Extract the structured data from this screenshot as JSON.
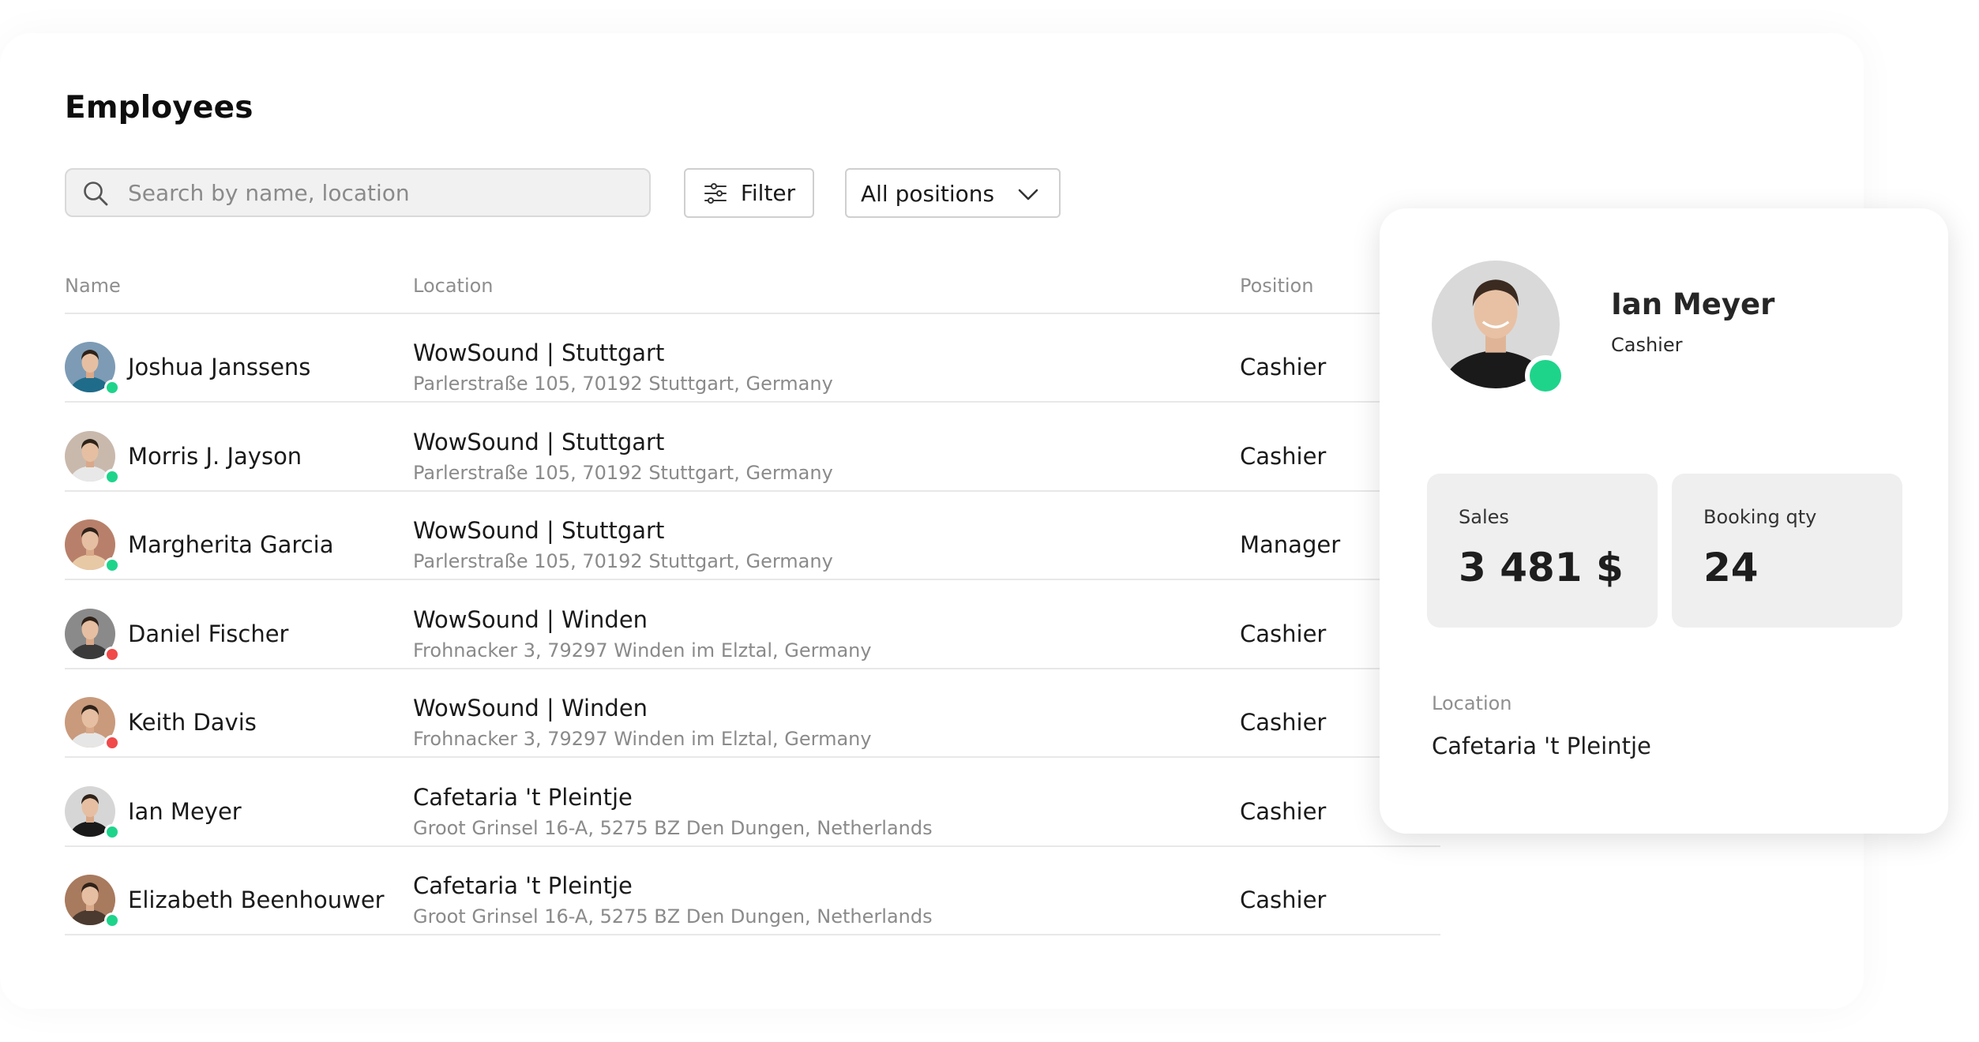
{
  "page": {
    "title": "Employees"
  },
  "search": {
    "placeholder": "Search by name, location"
  },
  "filter": {
    "label": "Filter"
  },
  "positions_select": {
    "selected": "All positions"
  },
  "table": {
    "columns": {
      "name": "Name",
      "location": "Location",
      "position": "Position"
    },
    "rows": [
      {
        "name": "Joshua Janssens",
        "location_name": "WowSound | Stuttgart",
        "location_address": "Parlerstraße 105, 70192 Stuttgart, Germany",
        "position": "Cashier",
        "status": "online"
      },
      {
        "name": "Morris J. Jayson",
        "location_name": "WowSound | Stuttgart",
        "location_address": "Parlerstraße 105, 70192 Stuttgart, Germany",
        "position": "Cashier",
        "status": "online"
      },
      {
        "name": "Margherita Garcia",
        "location_name": "WowSound | Stuttgart",
        "location_address": "Parlerstraße 105, 70192 Stuttgart, Germany",
        "position": "Manager",
        "status": "online"
      },
      {
        "name": "Daniel Fischer",
        "location_name": "WowSound | Winden",
        "location_address": "Frohnacker 3, 79297 Winden im Elztal, Germany",
        "position": "Cashier",
        "status": "offline"
      },
      {
        "name": "Keith Davis",
        "location_name": "WowSound | Winden",
        "location_address": "Frohnacker 3, 79297 Winden im Elztal, Germany",
        "position": "Cashier",
        "status": "offline"
      },
      {
        "name": "Ian Meyer",
        "location_name": "Cafetaria 't Pleintje",
        "location_address": "Groot Grinsel 16-A, 5275 BZ Den Dungen, Netherlands",
        "position": "Cashier",
        "status": "online"
      },
      {
        "name": "Elizabeth Beenhouwer",
        "location_name": "Cafetaria 't Pleintje",
        "location_address": "Groot Grinsel 16-A, 5275 BZ Den Dungen, Netherlands",
        "position": "Cashier",
        "status": "online"
      }
    ]
  },
  "detail": {
    "name": "Ian Meyer",
    "role": "Cashier",
    "status": "online",
    "sales_label": "Sales",
    "sales_value": "3 481 $",
    "booking_label": "Booking qty",
    "booking_value": "24",
    "location_label": "Location",
    "location_value": "Cafetaria 't Pleintje"
  },
  "colors": {
    "online": "#1ed48b",
    "offline": "#f04a4a",
    "avatar_bg": [
      "#7d9bb5",
      "#c9b9ad",
      "#b8806a",
      "#8a8a8a",
      "#c99a7c",
      "#d6d6d6",
      "#a87a5e"
    ],
    "shirt": [
      "#1f6b8a",
      "#e8e8e8",
      "#e8c9a5",
      "#3a3a3a",
      "#e6e6e6",
      "#1a1a1a",
      "#4a3a30"
    ]
  },
  "icons": {
    "search": "search-icon",
    "filter": "sliders-icon",
    "dropdown": "chevron-down-icon"
  }
}
